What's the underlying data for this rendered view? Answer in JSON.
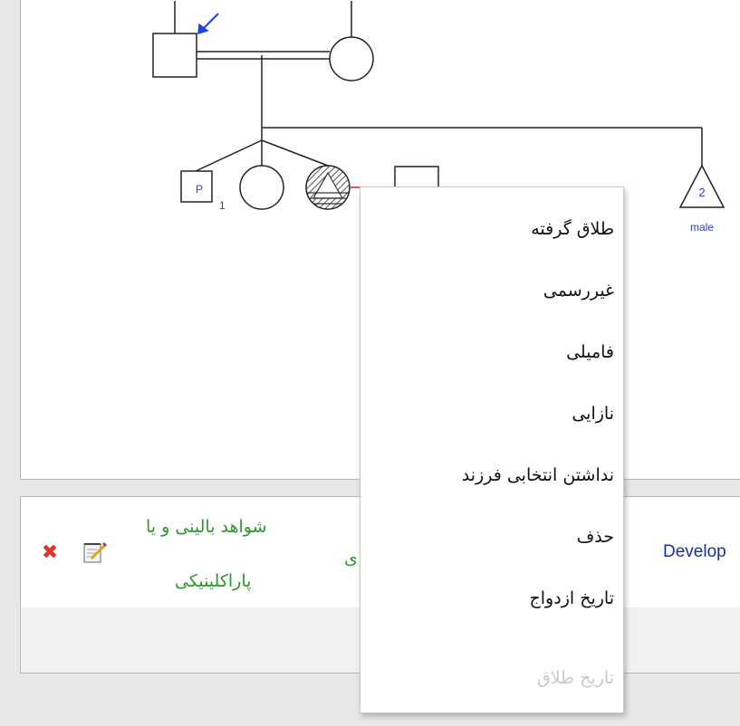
{
  "pedigree": {
    "proband_symbol_label": "P",
    "proband_index": "1",
    "sibling_count_label": "2",
    "sibling_gender_label": "male"
  },
  "context_menu": {
    "items": [
      {
        "label": "طلاق گرفته",
        "enabled": true
      },
      {
        "label": "غیررسمی",
        "enabled": true
      },
      {
        "label": "فامیلی",
        "enabled": true
      },
      {
        "label": "نازایی",
        "enabled": true
      },
      {
        "label": "نداشتن انتخابی فرزند",
        "enabled": true
      },
      {
        "label": "حذف",
        "enabled": true
      },
      {
        "label": "تاریخ ازدواج",
        "enabled": true
      },
      {
        "label": "تاریخ طلاق",
        "enabled": false
      }
    ]
  },
  "record_row": {
    "evidence_line1": "شواهد بالینی و یا",
    "evidence_line2": "پاراکلینیکی",
    "partial_text": "ی",
    "develop_text": "Develop"
  },
  "icons": {
    "delete": "close-x-icon",
    "edit": "notepad-pencil-icon"
  },
  "colors": {
    "accent_blue": "#1a2fa0",
    "arrow_blue": "#2244dd",
    "green_text": "#2a9a2a",
    "delete_red": "#e0352b",
    "spouse_line_red": "#e02020"
  }
}
